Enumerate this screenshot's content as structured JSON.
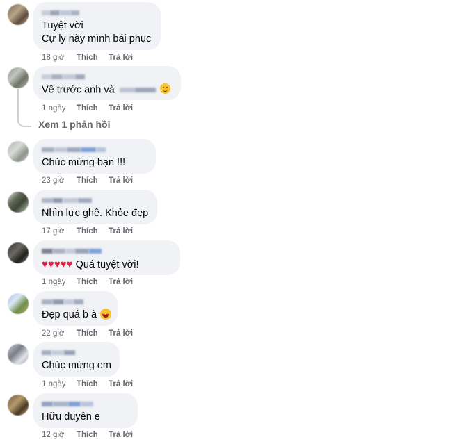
{
  "comments": [
    {
      "text": "Tuyệt vời",
      "text2": "Cự ly này mình bái phục",
      "time": "18 giờ",
      "like": "Thích",
      "reply": "Trả lời"
    },
    {
      "text": "Về trước anh và",
      "time": "1 ngày",
      "like": "Thích",
      "reply": "Trả lời",
      "emoji": "smile-icon"
    },
    {
      "text": "Chúc mừng bạn !!!",
      "time": "23 giờ",
      "like": "Thích",
      "reply": "Trả lời"
    },
    {
      "text": "Nhìn lực ghê. Khỏe đẹp",
      "time": "17 giờ",
      "like": "Thích",
      "reply": "Trả lời"
    },
    {
      "hearts": "♥♥♥♥♥",
      "text": "Quá tuyệt vời!",
      "time": "1 ngày",
      "like": "Thích",
      "reply": "Trả lời"
    },
    {
      "text": "Đẹp quá b à",
      "time": "22 giờ",
      "like": "Thích",
      "reply": "Trả lời",
      "emoji": "heart-eyes-icon"
    },
    {
      "text": "Chúc mừng em",
      "time": "1 ngày",
      "like": "Thích",
      "reply": "Trả lời"
    },
    {
      "text": "Hữu duyên e",
      "time": "12 giờ",
      "like": "Thích",
      "reply": "Trả lời"
    }
  ],
  "view_replies": "Xem 1 phản hồi",
  "colors": {
    "bubble": "#f0f2f5",
    "meta": "#65676b",
    "heart": "#e41e3f"
  }
}
